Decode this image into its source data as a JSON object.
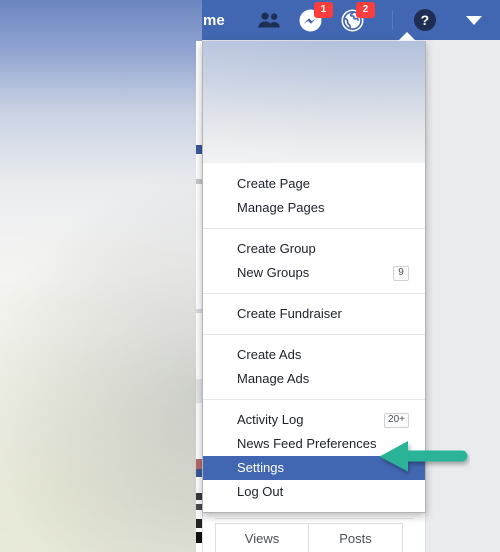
{
  "topbar": {
    "home_label": "me",
    "friends_icon": "friends-icon",
    "messenger_icon": "messenger-icon",
    "messenger_badge": "1",
    "notifications_icon": "globe-notifications-icon",
    "notifications_badge": "2",
    "help_icon": "question-mark-icon",
    "help_label": "?",
    "account_caret_icon": "chevron-down-icon",
    "bar_color": "#4267b2",
    "badge_color": "#fa3e3e"
  },
  "dropdown": {
    "sections": [
      {
        "name": "pages",
        "items": [
          {
            "label": "Create Page",
            "count": "",
            "selected": false
          },
          {
            "label": "Manage Pages",
            "count": "",
            "selected": false
          }
        ]
      },
      {
        "name": "groups",
        "items": [
          {
            "label": "Create Group",
            "count": "",
            "selected": false
          },
          {
            "label": "New Groups",
            "count": "9",
            "selected": false
          }
        ]
      },
      {
        "name": "fundraiser",
        "items": [
          {
            "label": "Create Fundraiser",
            "count": "",
            "selected": false
          }
        ]
      },
      {
        "name": "ads",
        "items": [
          {
            "label": "Create Ads",
            "count": "",
            "selected": false
          },
          {
            "label": "Manage Ads",
            "count": "",
            "selected": false
          }
        ]
      },
      {
        "name": "account",
        "items": [
          {
            "label": "Activity Log",
            "count": "20+",
            "selected": false
          },
          {
            "label": "News Feed Preferences",
            "count": "",
            "selected": false
          },
          {
            "label": "Settings",
            "count": "",
            "selected": true
          },
          {
            "label": "Log Out",
            "count": "",
            "selected": false
          }
        ]
      }
    ],
    "highlight_color": "#4267b2",
    "highlight_text_color": "#ffffff"
  },
  "content_below": {
    "tabs": [
      {
        "label": "Views"
      },
      {
        "label": "Posts"
      }
    ]
  },
  "annotation": {
    "arrow_icon": "left-pointing-arrow",
    "arrow_color": "#2bb396",
    "points_at": "Settings"
  }
}
